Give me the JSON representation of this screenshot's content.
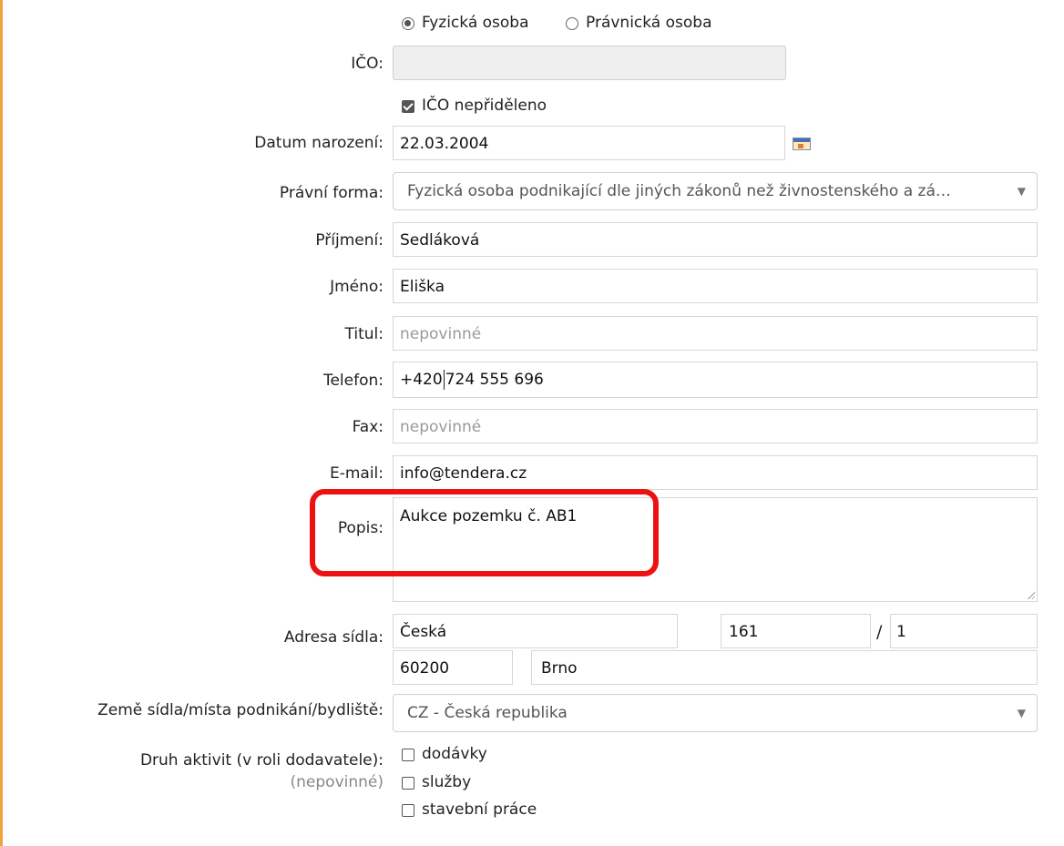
{
  "entity_type": {
    "options": [
      {
        "label": "Fyzická osoba",
        "selected": true
      },
      {
        "label": "Právnická osoba",
        "selected": false
      }
    ]
  },
  "ico": {
    "label": "IČO:",
    "value": ""
  },
  "ico_not_assigned": {
    "label": "IČO nepřiděleno",
    "checked": true
  },
  "birth_date": {
    "label": "Datum narození:",
    "value": "22.03.2004",
    "icon": "calendar-icon"
  },
  "legal_form": {
    "label": "Právní forma:",
    "value": "Fyzická osoba podnikající dle jiných zákonů než živnostenského a zá…"
  },
  "surname": {
    "label": "Příjmení:",
    "value": "Sedláková"
  },
  "first_name": {
    "label": "Jméno:",
    "value": "Eliška"
  },
  "title": {
    "label": "Titul:",
    "placeholder": "nepovinné"
  },
  "phone": {
    "label": "Telefon:",
    "prefix": "+420",
    "number": "724 555 696"
  },
  "fax": {
    "label": "Fax:",
    "placeholder": "nepovinné"
  },
  "email": {
    "label": "E-mail:",
    "value": "info@tendera.cz"
  },
  "description": {
    "label": "Popis:",
    "value": "Aukce pozemku č. AB1"
  },
  "address": {
    "label": "Adresa sídla:",
    "street": "Česká",
    "house_number": "161",
    "separator": "/",
    "orientation_number": "1",
    "zip": "60200",
    "city": "Brno"
  },
  "country": {
    "label": "Země sídla/místa podnikání/bydliště:",
    "value": "CZ - Česká republika"
  },
  "activities": {
    "label": "Druh aktivit (v roli dodavatele):",
    "hint": "(nepovinné)",
    "options": [
      {
        "label": "dodávky",
        "checked": false
      },
      {
        "label": "služby",
        "checked": false
      },
      {
        "label": "stavební práce",
        "checked": false
      }
    ]
  },
  "colors": {
    "highlight": "#ee1111",
    "frame_border": "#f0a33a",
    "disabled_bg": "#efefef"
  }
}
